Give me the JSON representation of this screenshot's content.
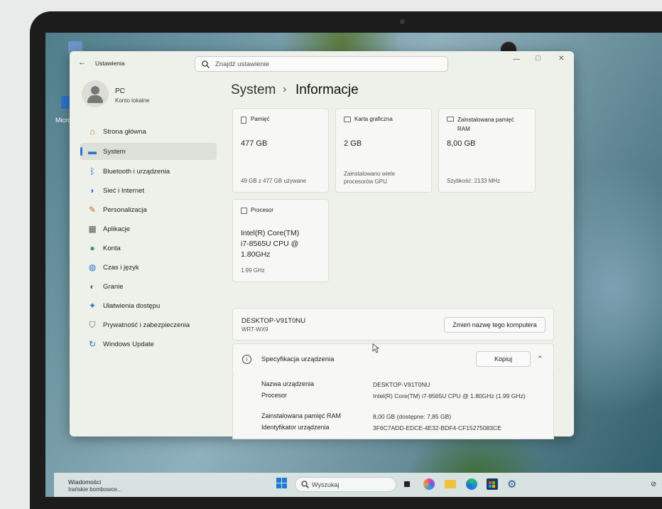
{
  "desktop": {
    "icon_label": "Micro"
  },
  "window": {
    "app_title": "Ustawienia",
    "search_placeholder": "Znajdź ustawienie",
    "controls": {
      "minimize": "—",
      "maximize": "□",
      "close": "✕"
    }
  },
  "user": {
    "name": "PC",
    "account": "Konto lokalne"
  },
  "sidebar": {
    "items": [
      {
        "label": "Strona główna",
        "icon": "home-icon",
        "color": "#c8742a"
      },
      {
        "label": "System",
        "icon": "monitor-icon",
        "color": "#2d72c8"
      },
      {
        "label": "Bluetooth i urządzenia",
        "icon": "bluetooth-icon",
        "color": "#2d72c8"
      },
      {
        "label": "Sieć i Internet",
        "icon": "wifi-icon",
        "color": "#2d72c8"
      },
      {
        "label": "Personalizacja",
        "icon": "brush-icon",
        "color": "#c86a2a"
      },
      {
        "label": "Aplikacje",
        "icon": "apps-icon",
        "color": "#555"
      },
      {
        "label": "Konta",
        "icon": "person-icon",
        "color": "#2d9a6a"
      },
      {
        "label": "Czas i język",
        "icon": "globe-icon",
        "color": "#2d72c8"
      },
      {
        "label": "Granie",
        "icon": "gamepad-icon",
        "color": "#666"
      },
      {
        "label": "Ułatwienia dostępu",
        "icon": "accessibility-icon",
        "color": "#2d72c8"
      },
      {
        "label": "Prywatność i zabezpieczenia",
        "icon": "shield-icon",
        "color": "#666"
      },
      {
        "label": "Windows Update",
        "icon": "update-icon",
        "color": "#2d72c8"
      }
    ]
  },
  "breadcrumb": {
    "parent": "System",
    "separator": "›",
    "current": "Informacje"
  },
  "cards": {
    "storage": {
      "title": "Pamięć",
      "value": "477 GB",
      "detail": "49 GB z 477 GB używane"
    },
    "gpu": {
      "title": "Karta graficzna",
      "value": "2 GB",
      "detail": "Zainstalowano wiele procesorów GPU"
    },
    "ram": {
      "title": "Zainstalowana pamięć RAM",
      "value": "8,00 GB",
      "detail": "Szybkość: 2133 MHz"
    },
    "cpu": {
      "title": "Procesor",
      "value": "Intel(R) Core(TM) i7-8565U CPU @ 1.80GHz",
      "detail": "1.99 GHz"
    }
  },
  "device": {
    "name": "DESKTOP-V91T0NU",
    "model": "WRT-WX9",
    "rename_button": "Zmień nazwę tego komputera"
  },
  "specs": {
    "title": "Specyfikacja urządzenia",
    "copy_button": "Kopiuj",
    "rows": [
      {
        "label": "Nazwa urządzenia",
        "value": "DESKTOP-V91T0NU"
      },
      {
        "label": "Procesor",
        "value": "Intel(R) Core(TM) i7-8565U CPU @ 1.80GHz (1.99 GHz)"
      },
      {
        "label": "Zainstalowana pamięć RAM",
        "value": "8,00 GB (dostępne: 7,85 GB)"
      },
      {
        "label": "Identyfikator urządzenia",
        "value": "3F6C7ADD-EDCE-4E32-BDF4-CF15275083CE"
      }
    ]
  },
  "taskbar": {
    "notif_title": "Wiadomości",
    "notif_text": "Irańskie bombowce...",
    "search_placeholder": "Wyszukaj"
  }
}
